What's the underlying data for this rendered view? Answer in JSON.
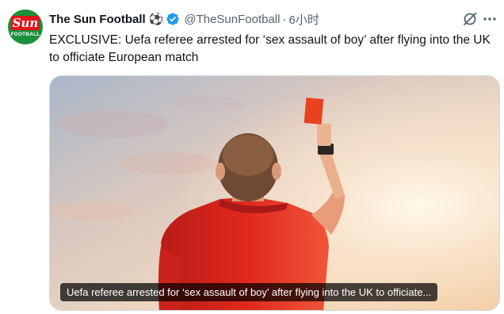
{
  "account": {
    "name": "The Sun Football",
    "emoji": "⚽",
    "handle": "@TheSunFootball",
    "separator": "·",
    "time": "6小时",
    "avatar_text": "Sun",
    "avatar_subtext": "FOOTBALL"
  },
  "tweet": {
    "text": "EXCLUSIVE: Uefa referee arrested for ‘sex assault of boy’ after flying into the UK to officiate European match"
  },
  "media": {
    "caption": "Uefa referee arrested for ‘sex assault of boy’ after flying into the UK to officiate..."
  },
  "icons": {
    "verified": "verified-badge-icon",
    "grok": "grok-icon",
    "more": "more-icon"
  },
  "colors": {
    "verified_blue": "#1d9bf0",
    "secondary_text": "#536471",
    "sun_red": "#e3131a",
    "avatar_green": "#1c8f3a",
    "shirt_red": "#e0281c",
    "card_orange": "#e8431f"
  }
}
